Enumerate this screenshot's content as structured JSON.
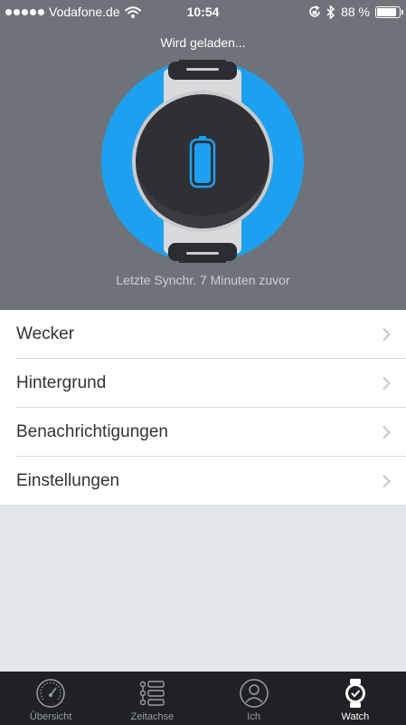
{
  "status_bar": {
    "carrier": "Vodafone.de",
    "time": "10:54",
    "battery_percent": "88 %",
    "battery_level": 0.88
  },
  "sync": {
    "loading_text": "Wird geladen...",
    "last_sync_text": "Letzte Synchr. 7 Minuten zuvor"
  },
  "colors": {
    "header_bg": "#6d7379",
    "accent_blue": "#1ea0f0",
    "list_bg": "#ffffff",
    "page_bg": "#e4e7ea",
    "tabbar_bg": "#1f2124"
  },
  "menu": {
    "items": [
      {
        "label": "Wecker"
      },
      {
        "label": "Hintergrund"
      },
      {
        "label": "Benachrichtigungen"
      },
      {
        "label": "Einstellungen"
      }
    ]
  },
  "tabs": {
    "items": [
      {
        "label": "Übersicht",
        "icon": "gauge-icon"
      },
      {
        "label": "Zeitachse",
        "icon": "timeline-icon"
      },
      {
        "label": "Ich",
        "icon": "person-icon"
      },
      {
        "label": "Watch",
        "icon": "watch-icon"
      }
    ],
    "active": "Watch"
  }
}
